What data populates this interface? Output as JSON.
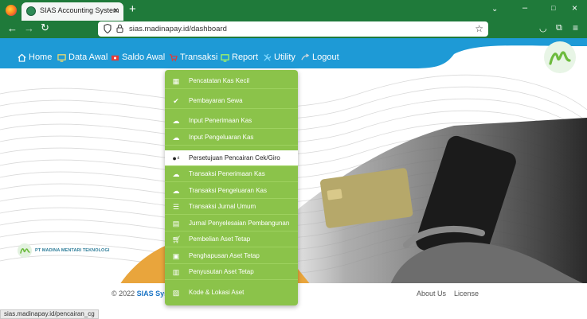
{
  "browser": {
    "tab_title": "SIAS Accounting System",
    "url": "sias.madinapay.id/dashboard",
    "status_url": "sias.madinapay.id/pencairan_cg"
  },
  "nav": {
    "items": [
      {
        "label": "Home",
        "icon": "home-icon"
      },
      {
        "label": "Data Awal",
        "icon": "monitor-icon"
      },
      {
        "label": "Saldo Awal",
        "icon": "money-icon"
      },
      {
        "label": "Transaksi",
        "icon": "cart-icon"
      },
      {
        "label": "Report",
        "icon": "report-icon"
      },
      {
        "label": "Utility",
        "icon": "tools-icon"
      },
      {
        "label": "Logout",
        "icon": "logout-icon"
      }
    ]
  },
  "dropdown": {
    "items": [
      {
        "label": "Pencatatan Kas Kecil",
        "icon": "calculator-icon"
      },
      {
        "label": "Pembayaran Sewa",
        "icon": "check-icon"
      },
      {
        "label": "Input Penerimaan Kas",
        "icon": "cloud-upload-icon"
      },
      {
        "label": "Input Pengeluaran Kas",
        "icon": "cloud-upload-icon"
      },
      {
        "label": "Persetujuan Pencairan Cek/Giro",
        "icon": "approval-icon",
        "active": true
      },
      {
        "label": "Transaksi Penerimaan Kas",
        "icon": "cloud-upload-icon"
      },
      {
        "label": "Transaksi Pengeluaran Kas",
        "icon": "cloud-upload-icon"
      },
      {
        "label": "Transaksi Jurnal Umum",
        "icon": "list-icon"
      },
      {
        "label": "Jurnal Penyelesaian Pembangunan",
        "icon": "archive-icon"
      },
      {
        "label": "Pembelian Aset Tetap",
        "icon": "cart-icon"
      },
      {
        "label": "Penghapusan Aset Tetap",
        "icon": "trash-icon"
      },
      {
        "label": "Penyusutan Aset Tetap",
        "icon": "calendar-icon"
      },
      {
        "label": "Kode & Lokasi Aset",
        "icon": "image-icon"
      }
    ]
  },
  "company": {
    "name": "PT MADINA MENTARI TEKNOLOGI"
  },
  "footer": {
    "copyright_prefix": "© 2022",
    "brand": "SIAS Syst",
    "about": "About Us",
    "license": "License"
  },
  "colors": {
    "browser_green": "#1f7a3a",
    "header_blue": "#1e9ad6",
    "menu_green": "#8bc34a"
  }
}
